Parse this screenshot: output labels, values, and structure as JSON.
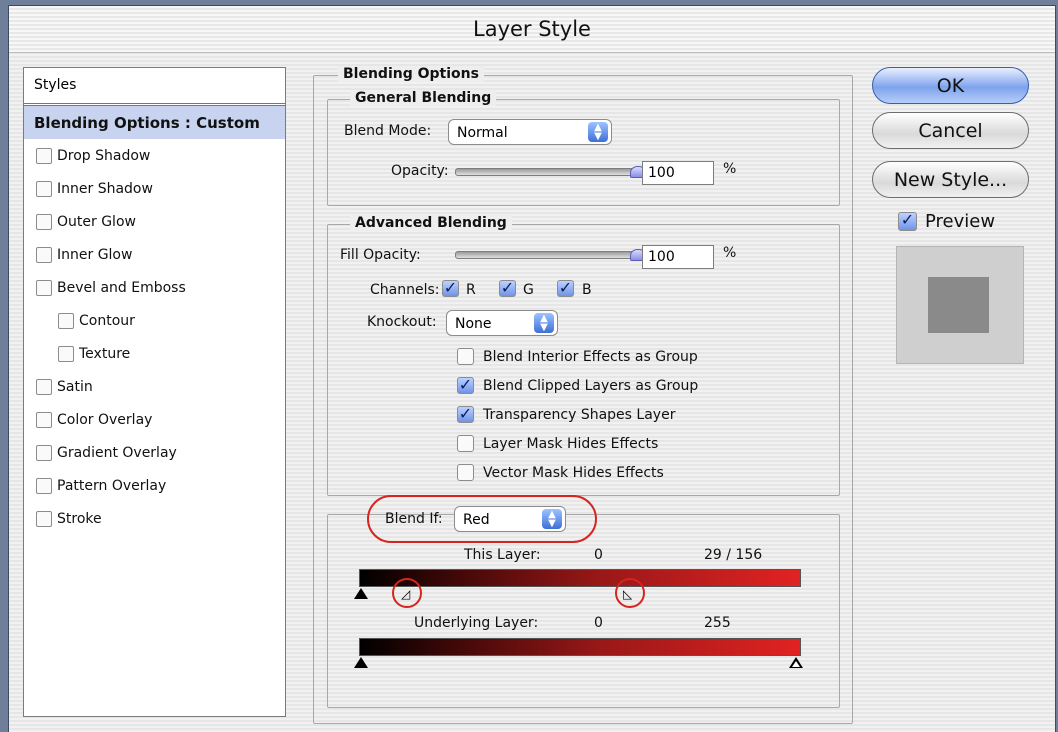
{
  "window": {
    "title": "Layer Style"
  },
  "styles_list": {
    "header": "Styles",
    "selected": "Blending Options : Custom",
    "items": [
      {
        "label": "Drop Shadow",
        "checked": false,
        "sub": false
      },
      {
        "label": "Inner Shadow",
        "checked": false,
        "sub": false
      },
      {
        "label": "Outer Glow",
        "checked": false,
        "sub": false
      },
      {
        "label": "Inner Glow",
        "checked": false,
        "sub": false
      },
      {
        "label": "Bevel and Emboss",
        "checked": false,
        "sub": false
      },
      {
        "label": "Contour",
        "checked": false,
        "sub": true
      },
      {
        "label": "Texture",
        "checked": false,
        "sub": true
      },
      {
        "label": "Satin",
        "checked": false,
        "sub": false
      },
      {
        "label": "Color Overlay",
        "checked": false,
        "sub": false
      },
      {
        "label": "Gradient Overlay",
        "checked": false,
        "sub": false
      },
      {
        "label": "Pattern Overlay",
        "checked": false,
        "sub": false
      },
      {
        "label": "Stroke",
        "checked": false,
        "sub": false
      }
    ]
  },
  "blending_options": {
    "title": "Blending Options",
    "general": {
      "title": "General Blending",
      "blend_mode_label": "Blend Mode:",
      "blend_mode_value": "Normal",
      "opacity_label": "Opacity:",
      "opacity_value": "100",
      "opacity_fraction": 1.0,
      "percent": "%"
    },
    "advanced": {
      "title": "Advanced Blending",
      "fill_opacity_label": "Fill Opacity:",
      "fill_opacity_value": "100",
      "fill_opacity_fraction": 1.0,
      "percent": "%",
      "channels_label": "Channels:",
      "channels": [
        {
          "label": "R",
          "checked": true
        },
        {
          "label": "G",
          "checked": true
        },
        {
          "label": "B",
          "checked": true
        }
      ],
      "knockout_label": "Knockout:",
      "knockout_value": "None",
      "options": [
        {
          "label": "Blend Interior Effects as Group",
          "checked": false
        },
        {
          "label": "Blend Clipped Layers as Group",
          "checked": true
        },
        {
          "label": "Transparency Shapes Layer",
          "checked": true
        },
        {
          "label": "Layer Mask Hides Effects",
          "checked": false
        },
        {
          "label": "Vector Mask Hides Effects",
          "checked": false
        }
      ]
    },
    "blend_if": {
      "label": "Blend If:",
      "value": "Red",
      "this_layer_label": "This Layer:",
      "this_layer_low": "0",
      "this_layer_high": "29 / 156",
      "underlying_label": "Underlying Layer:",
      "underlying_low": "0",
      "underlying_high": "255"
    }
  },
  "buttons": {
    "ok": "OK",
    "cancel": "Cancel",
    "new_style": "New Style...",
    "preview_label": "Preview",
    "preview_checked": true
  },
  "colors": {
    "annotation": "#d5251f",
    "selection": "#c8d3ef"
  }
}
